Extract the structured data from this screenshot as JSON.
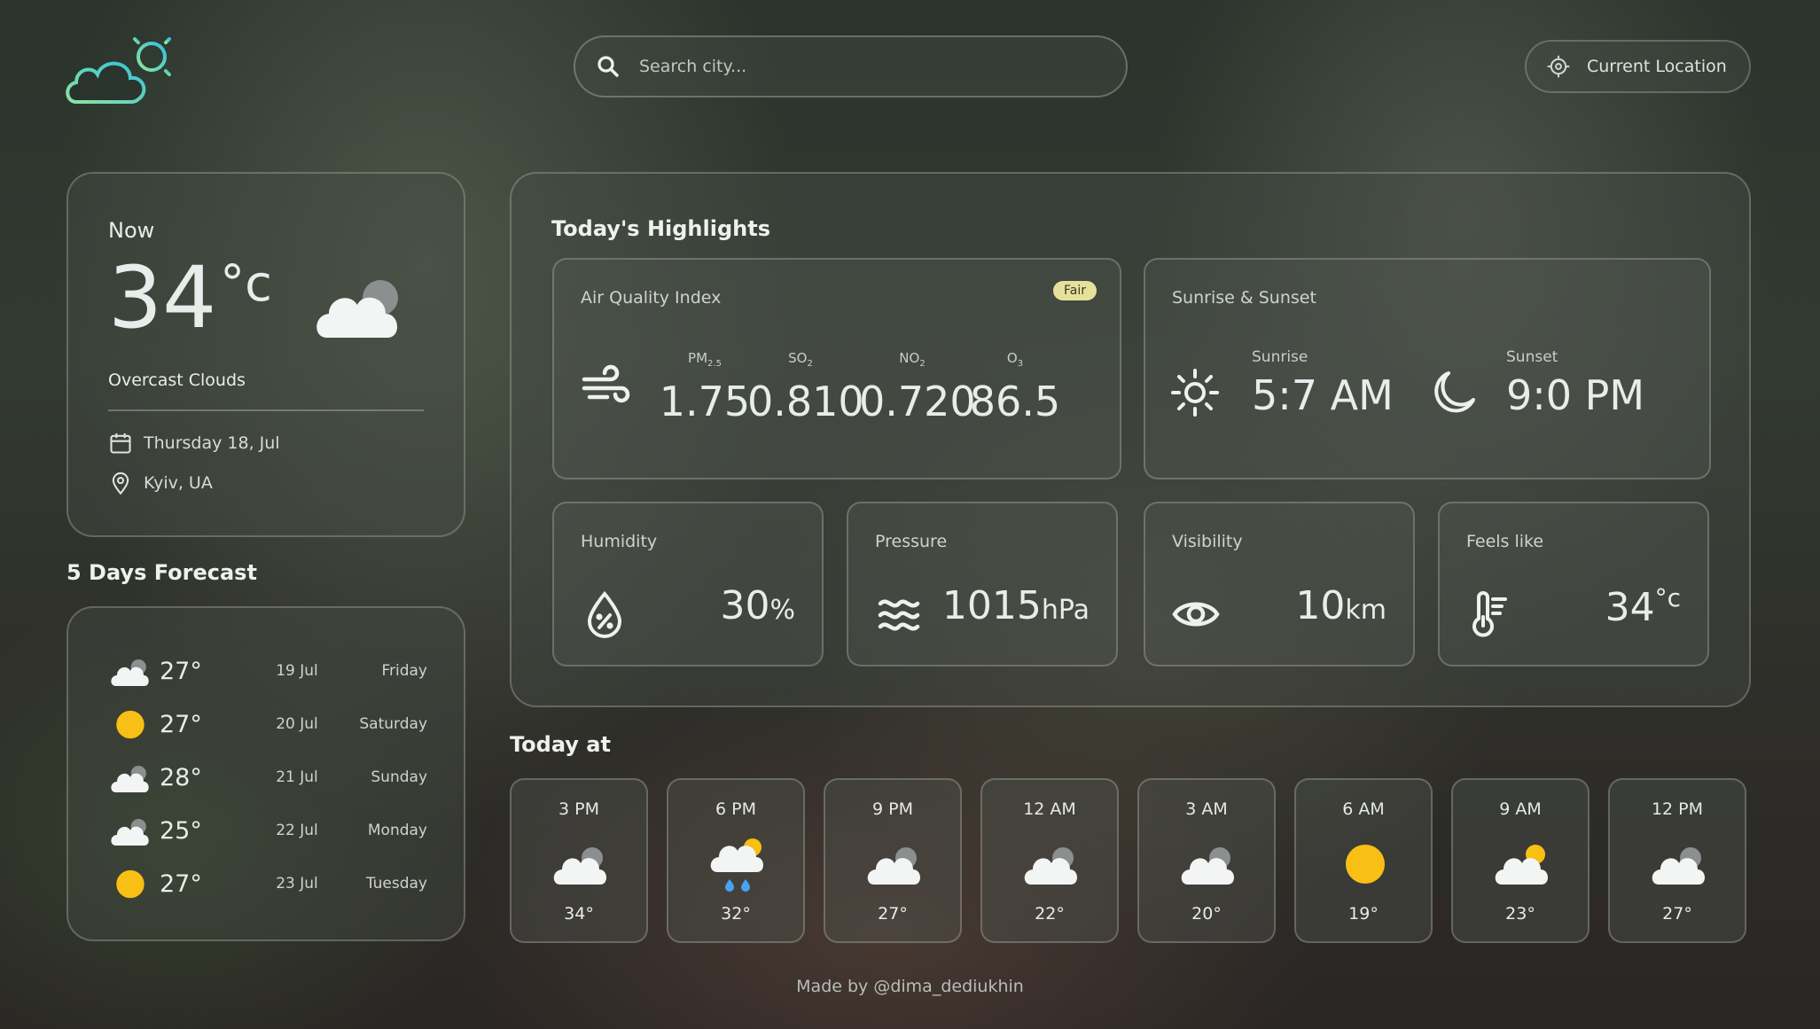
{
  "header": {
    "search_placeholder": "Search city...",
    "location_button": "Current Location"
  },
  "now": {
    "label": "Now",
    "temp": "34",
    "unit": "°c",
    "description": "Overcast Clouds",
    "date": "Thursday 18, Jul",
    "location": "Kyiv, UA",
    "icon": "overcast-cloud-icon"
  },
  "forecast": {
    "title": "5 Days Forecast",
    "days": [
      {
        "icon": "cloud-icon",
        "temp": "27°",
        "date": "19 Jul",
        "weekday": "Friday"
      },
      {
        "icon": "sun-icon",
        "temp": "27°",
        "date": "20 Jul",
        "weekday": "Saturday"
      },
      {
        "icon": "cloud-icon",
        "temp": "28°",
        "date": "21 Jul",
        "weekday": "Sunday"
      },
      {
        "icon": "cloud-icon",
        "temp": "25°",
        "date": "22 Jul",
        "weekday": "Monday"
      },
      {
        "icon": "sun-icon",
        "temp": "27°",
        "date": "23 Jul",
        "weekday": "Tuesday"
      }
    ]
  },
  "highlights": {
    "title": "Today's Highlights",
    "aqi": {
      "label": "Air Quality Index",
      "badge": "Fair",
      "items": [
        {
          "key_main": "PM",
          "key_sub": "2.5",
          "value": "1.75"
        },
        {
          "key_main": "SO",
          "key_sub": "2",
          "value": "0.810"
        },
        {
          "key_main": "NO",
          "key_sub": "2",
          "value": "0.720"
        },
        {
          "key_main": "O",
          "key_sub": "3",
          "value": "86.5"
        }
      ]
    },
    "sun": {
      "label": "Sunrise & Sunset",
      "sunrise_label": "Sunrise",
      "sunrise": "5:7 AM",
      "sunset_label": "Sunset",
      "sunset": "9:0 PM"
    },
    "humidity": {
      "label": "Humidity",
      "value": "30",
      "unit": "%"
    },
    "pressure": {
      "label": "Pressure",
      "value": "1015",
      "unit": "hPa"
    },
    "visibility": {
      "label": "Visibility",
      "value": "10",
      "unit": "km"
    },
    "feels_like": {
      "label": "Feels like",
      "value": "34",
      "unit": "°c"
    }
  },
  "today": {
    "title": "Today at",
    "hours": [
      {
        "time": "3 PM",
        "icon": "cloud-icon",
        "temp": "34°"
      },
      {
        "time": "6 PM",
        "icon": "rain-sun-icon",
        "temp": "32°"
      },
      {
        "time": "9 PM",
        "icon": "cloud-icon",
        "temp": "27°"
      },
      {
        "time": "12 AM",
        "icon": "cloud-icon",
        "temp": "22°"
      },
      {
        "time": "3 AM",
        "icon": "cloud-icon",
        "temp": "20°"
      },
      {
        "time": "6 AM",
        "icon": "sun-icon",
        "temp": "19°"
      },
      {
        "time": "9 AM",
        "icon": "partly-cloudy-icon",
        "temp": "23°"
      },
      {
        "time": "12 PM",
        "icon": "cloud-icon",
        "temp": "27°"
      }
    ]
  },
  "footer": {
    "text": "Made by @dima_dediukhin"
  },
  "colors": {
    "sun": "#f8bf14",
    "rain": "#4aa3f0",
    "badge": "#e7e09a",
    "logo_from": "#7ee0a5",
    "logo_to": "#3fc6d8"
  }
}
